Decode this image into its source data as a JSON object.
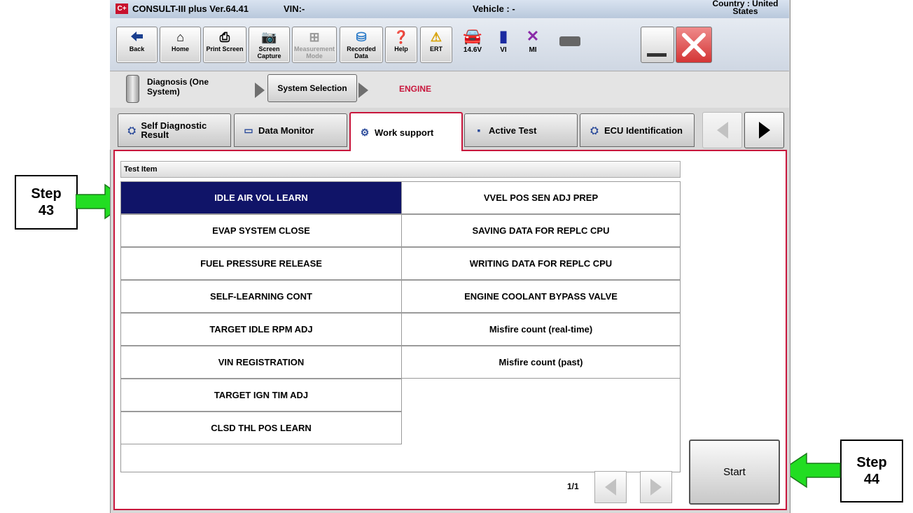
{
  "title_bar": {
    "app_name": "CONSULT-III plus  Ver.64.41",
    "vin": "VIN:-",
    "vehicle": "Vehicle : -",
    "country": "Country : United States",
    "logo": "C+"
  },
  "toolbar": {
    "back": "Back",
    "home": "Home",
    "print_screen": "Print Screen",
    "screen_capture": "Screen Capture",
    "measurement_mode": "Measurement Mode",
    "recorded_data": "Recorded Data",
    "help": "Help",
    "ert": "ERT",
    "battery_voltage": "14.6V",
    "vi": "VI",
    "mi": "MI"
  },
  "breadcrumb": {
    "diagnosis": "Diagnosis (One System)",
    "system_selection": "System Selection",
    "current": "ENGINE"
  },
  "tabs": [
    {
      "label": "Self Diagnostic Result"
    },
    {
      "label": "Data Monitor"
    },
    {
      "label": "Work support"
    },
    {
      "label": "Active Test"
    },
    {
      "label": "ECU Identification"
    }
  ],
  "list": {
    "header": "Test Item",
    "left_column": [
      "IDLE AIR VOL LEARN",
      "EVAP SYSTEM CLOSE",
      "FUEL PRESSURE RELEASE",
      "SELF-LEARNING CONT",
      "TARGET IDLE RPM ADJ",
      "VIN REGISTRATION",
      "TARGET IGN TIM ADJ",
      "CLSD THL POS LEARN"
    ],
    "right_column": [
      "VVEL POS SEN ADJ PREP",
      "SAVING DATA FOR REPLC CPU",
      "WRITING DATA FOR REPLC CPU",
      "ENGINE COOLANT BYPASS VALVE",
      "Misfire count (real-time)",
      "Misfire count (past)"
    ],
    "selected": "IDLE AIR VOL LEARN"
  },
  "pager": {
    "page": "1/1"
  },
  "start_button": "Start",
  "annotations": {
    "step43": [
      "Step",
      "43"
    ],
    "step44": [
      "Step",
      "44"
    ]
  },
  "colors": {
    "selected_row": "#101468",
    "active_tab_border": "#c8163c",
    "step_arrow": "#22dd22"
  }
}
